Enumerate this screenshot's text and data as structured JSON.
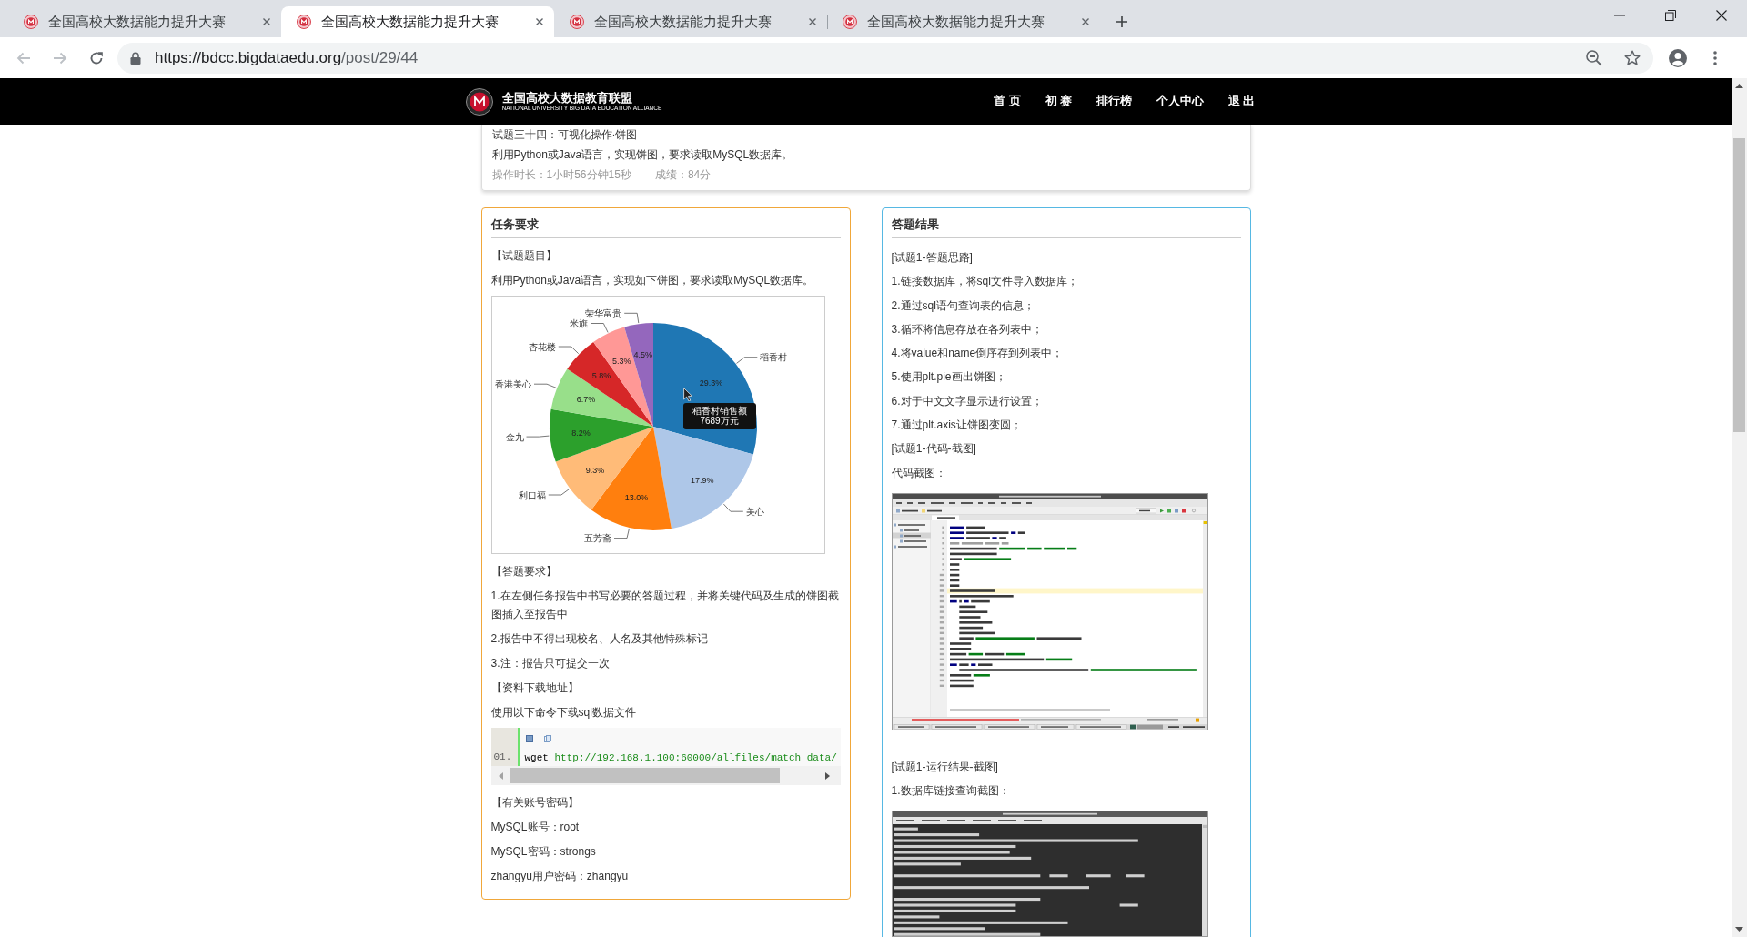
{
  "browser": {
    "tabs": [
      {
        "title": "全国高校大数据能力提升大赛",
        "selected": false
      },
      {
        "title": "全国高校大数据能力提升大赛",
        "selected": true
      },
      {
        "title": "全国高校大数据能力提升大赛",
        "selected": false
      },
      {
        "title": "全国高校大数据能力提升大赛",
        "selected": false
      }
    ],
    "back": {
      "disabled": true
    },
    "forward": {
      "disabled": true
    },
    "url": {
      "host": "https://bdcc.bigdataedu.org",
      "path": "/post/29/44"
    }
  },
  "header": {
    "logo_title": "全国高校大数据教育联盟",
    "logo_subtitle": "NATIONAL UNIVERSITY BIG DATA EDUCATION ALLIANCE",
    "nav": [
      "首 页",
      "初 赛",
      "排行榜",
      "个人中心",
      "退 出"
    ]
  },
  "exam": {
    "title": "试题三十四：可视化操作·饼图",
    "description": "利用Python或Java语言，实现饼图，要求读取MySQL数据库。",
    "duration": "操作时长：1小时56分钟15秒",
    "score": "成绩：84分"
  },
  "task": {
    "heading": "任务要求",
    "blocks": [
      {
        "kind": "text",
        "text": "【试题题目】"
      },
      {
        "kind": "text",
        "text": "利用Python或Java语言，实现如下饼图，要求读取MySQL数据库。"
      },
      {
        "kind": "chart",
        "chart_data": {
          "type": "pie",
          "categories": [
            "稻香村",
            "美心",
            "五芳斋",
            "利口福",
            "金九",
            "香港美心",
            "杏花楼",
            "米旗",
            "荣华富贵"
          ],
          "values": [
            29.3,
            17.9,
            13.0,
            9.3,
            8.2,
            6.7,
            5.8,
            5.3,
            4.5
          ],
          "value_labels": [
            "29.3%",
            "17.9%",
            "13.0%",
            "9.3%",
            "8.2%",
            "6.7%",
            "5.8%",
            "5.3%",
            "4.5%"
          ]
        },
        "tooltip": [
          "稻香村销售额",
          "7689万元"
        ]
      },
      {
        "kind": "text",
        "text": "【答题要求】"
      },
      {
        "kind": "text",
        "text": "1.在左侧任务报告中书写必要的答题过程，并将关键代码及生成的饼图截图插入至报告中"
      },
      {
        "kind": "text",
        "text": "2.报告中不得出现校名、人名及其他特殊标记"
      },
      {
        "kind": "text",
        "text": "3.注：报告只可提交一次"
      },
      {
        "kind": "text",
        "text": "【资料下载地址】"
      },
      {
        "kind": "text",
        "text": "使用以下命令下载sql数据文件"
      },
      {
        "kind": "code",
        "line_number": "01.",
        "command": "wget",
        "argument": "http://192.168.1.100:60000/allfiles/match_data/"
      },
      {
        "kind": "text",
        "text": "【有关账号密码】"
      },
      {
        "kind": "text",
        "text": "MySQL账号：root"
      },
      {
        "kind": "text",
        "text": "MySQL密码：strongs"
      },
      {
        "kind": "text",
        "text": "zhangyu用户密码：zhangyu"
      }
    ]
  },
  "result": {
    "heading": "答题结果",
    "blocks": [
      {
        "kind": "text",
        "text": "[试题1-答题思路]"
      },
      {
        "kind": "text",
        "text": "1.链接数据库，将sql文件导入数据库；"
      },
      {
        "kind": "text",
        "text": "2.通过sql语句查询表的信息；"
      },
      {
        "kind": "text",
        "text": "3.循环将信息存放在各列表中；"
      },
      {
        "kind": "text",
        "text": "4.将value和name倒序存到列表中；"
      },
      {
        "kind": "text",
        "text": "5.使用plt.pie画出饼图；"
      },
      {
        "kind": "text",
        "text": "6.对于中文文字显示进行设置；"
      },
      {
        "kind": "text",
        "text": "7.通过plt.axis让饼图变圆；"
      },
      {
        "kind": "text",
        "text": "[试题1-代码-截图]"
      },
      {
        "kind": "text",
        "text": "代码截图："
      },
      {
        "kind": "ide_screenshot"
      },
      {
        "kind": "text",
        "text": "[试题1-运行结果-截图]"
      },
      {
        "kind": "text",
        "text": "1.数据库链接查询截图："
      },
      {
        "kind": "terminal_screenshot"
      }
    ]
  }
}
